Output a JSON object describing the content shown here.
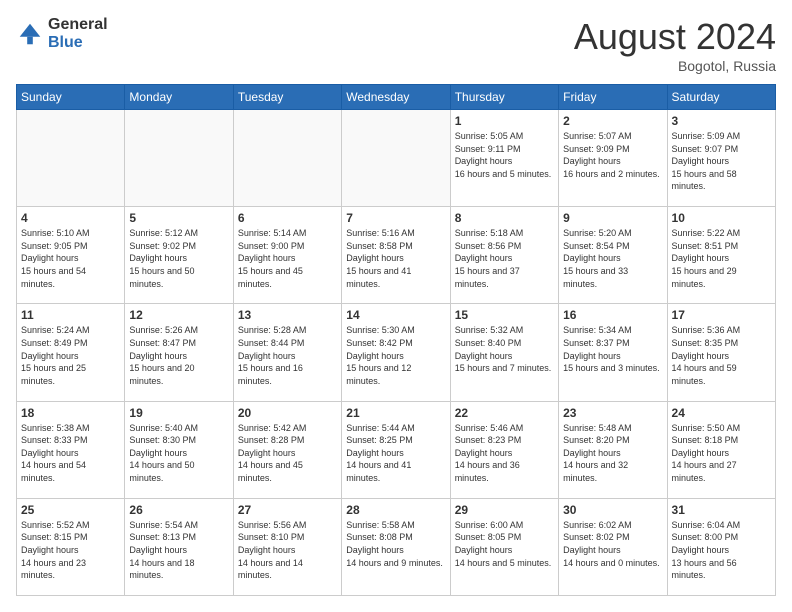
{
  "logo": {
    "general": "General",
    "blue": "Blue"
  },
  "header": {
    "month_year": "August 2024",
    "location": "Bogotol, Russia"
  },
  "days_of_week": [
    "Sunday",
    "Monday",
    "Tuesday",
    "Wednesday",
    "Thursday",
    "Friday",
    "Saturday"
  ],
  "weeks": [
    [
      {
        "day": "",
        "empty": true
      },
      {
        "day": "",
        "empty": true
      },
      {
        "day": "",
        "empty": true
      },
      {
        "day": "",
        "empty": true
      },
      {
        "day": "1",
        "sunrise": "5:05 AM",
        "sunset": "9:11 PM",
        "daylight": "16 hours and 5 minutes."
      },
      {
        "day": "2",
        "sunrise": "5:07 AM",
        "sunset": "9:09 PM",
        "daylight": "16 hours and 2 minutes."
      },
      {
        "day": "3",
        "sunrise": "5:09 AM",
        "sunset": "9:07 PM",
        "daylight": "15 hours and 58 minutes."
      }
    ],
    [
      {
        "day": "4",
        "sunrise": "5:10 AM",
        "sunset": "9:05 PM",
        "daylight": "15 hours and 54 minutes."
      },
      {
        "day": "5",
        "sunrise": "5:12 AM",
        "sunset": "9:02 PM",
        "daylight": "15 hours and 50 minutes."
      },
      {
        "day": "6",
        "sunrise": "5:14 AM",
        "sunset": "9:00 PM",
        "daylight": "15 hours and 45 minutes."
      },
      {
        "day": "7",
        "sunrise": "5:16 AM",
        "sunset": "8:58 PM",
        "daylight": "15 hours and 41 minutes."
      },
      {
        "day": "8",
        "sunrise": "5:18 AM",
        "sunset": "8:56 PM",
        "daylight": "15 hours and 37 minutes."
      },
      {
        "day": "9",
        "sunrise": "5:20 AM",
        "sunset": "8:54 PM",
        "daylight": "15 hours and 33 minutes."
      },
      {
        "day": "10",
        "sunrise": "5:22 AM",
        "sunset": "8:51 PM",
        "daylight": "15 hours and 29 minutes."
      }
    ],
    [
      {
        "day": "11",
        "sunrise": "5:24 AM",
        "sunset": "8:49 PM",
        "daylight": "15 hours and 25 minutes."
      },
      {
        "day": "12",
        "sunrise": "5:26 AM",
        "sunset": "8:47 PM",
        "daylight": "15 hours and 20 minutes."
      },
      {
        "day": "13",
        "sunrise": "5:28 AM",
        "sunset": "8:44 PM",
        "daylight": "15 hours and 16 minutes."
      },
      {
        "day": "14",
        "sunrise": "5:30 AM",
        "sunset": "8:42 PM",
        "daylight": "15 hours and 12 minutes."
      },
      {
        "day": "15",
        "sunrise": "5:32 AM",
        "sunset": "8:40 PM",
        "daylight": "15 hours and 7 minutes."
      },
      {
        "day": "16",
        "sunrise": "5:34 AM",
        "sunset": "8:37 PM",
        "daylight": "15 hours and 3 minutes."
      },
      {
        "day": "17",
        "sunrise": "5:36 AM",
        "sunset": "8:35 PM",
        "daylight": "14 hours and 59 minutes."
      }
    ],
    [
      {
        "day": "18",
        "sunrise": "5:38 AM",
        "sunset": "8:33 PM",
        "daylight": "14 hours and 54 minutes."
      },
      {
        "day": "19",
        "sunrise": "5:40 AM",
        "sunset": "8:30 PM",
        "daylight": "14 hours and 50 minutes."
      },
      {
        "day": "20",
        "sunrise": "5:42 AM",
        "sunset": "8:28 PM",
        "daylight": "14 hours and 45 minutes."
      },
      {
        "day": "21",
        "sunrise": "5:44 AM",
        "sunset": "8:25 PM",
        "daylight": "14 hours and 41 minutes."
      },
      {
        "day": "22",
        "sunrise": "5:46 AM",
        "sunset": "8:23 PM",
        "daylight": "14 hours and 36 minutes."
      },
      {
        "day": "23",
        "sunrise": "5:48 AM",
        "sunset": "8:20 PM",
        "daylight": "14 hours and 32 minutes."
      },
      {
        "day": "24",
        "sunrise": "5:50 AM",
        "sunset": "8:18 PM",
        "daylight": "14 hours and 27 minutes."
      }
    ],
    [
      {
        "day": "25",
        "sunrise": "5:52 AM",
        "sunset": "8:15 PM",
        "daylight": "14 hours and 23 minutes."
      },
      {
        "day": "26",
        "sunrise": "5:54 AM",
        "sunset": "8:13 PM",
        "daylight": "14 hours and 18 minutes."
      },
      {
        "day": "27",
        "sunrise": "5:56 AM",
        "sunset": "8:10 PM",
        "daylight": "14 hours and 14 minutes."
      },
      {
        "day": "28",
        "sunrise": "5:58 AM",
        "sunset": "8:08 PM",
        "daylight": "14 hours and 9 minutes."
      },
      {
        "day": "29",
        "sunrise": "6:00 AM",
        "sunset": "8:05 PM",
        "daylight": "14 hours and 5 minutes."
      },
      {
        "day": "30",
        "sunrise": "6:02 AM",
        "sunset": "8:02 PM",
        "daylight": "14 hours and 0 minutes."
      },
      {
        "day": "31",
        "sunrise": "6:04 AM",
        "sunset": "8:00 PM",
        "daylight": "13 hours and 56 minutes."
      }
    ]
  ]
}
